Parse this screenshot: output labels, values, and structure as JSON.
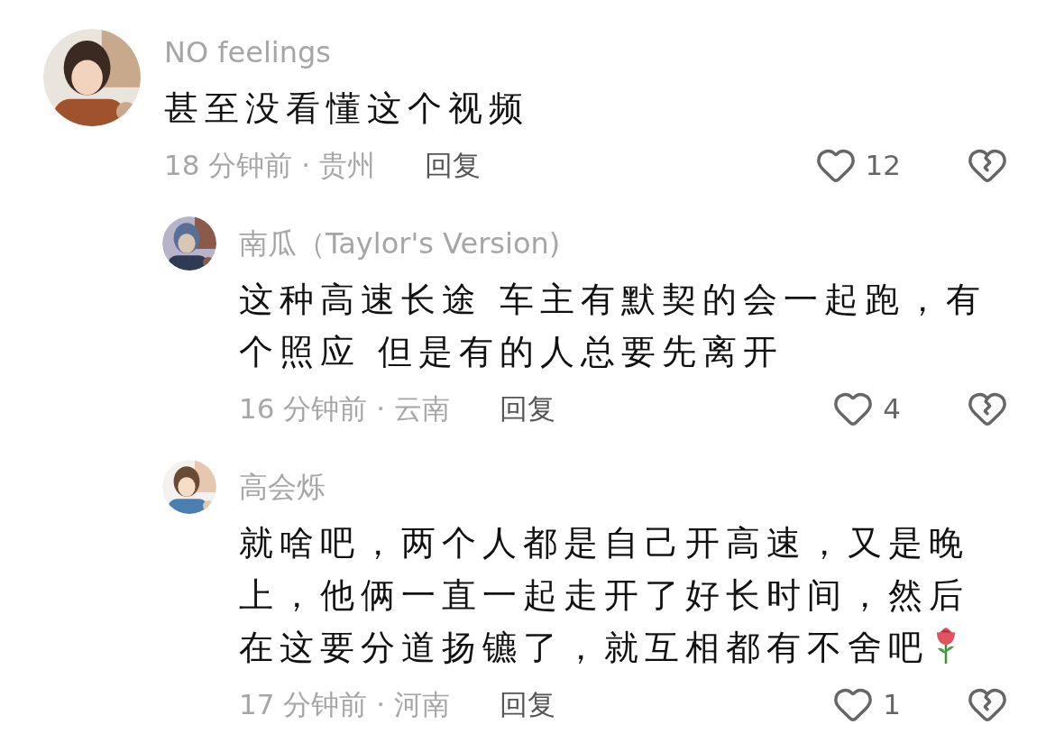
{
  "comments": [
    {
      "user": "NO feelings",
      "text": "甚至没看懂这个视频",
      "time": "18 分钟前 · 贵州",
      "reply": "回复",
      "likes": "12",
      "children": [
        {
          "user": "南瓜（Taylor's Version)",
          "text": "这种高速长途 车主有默契的会一起跑，有个照应 但是有的人总要先离开",
          "time": "16 分钟前 · 云南",
          "reply": "回复",
          "likes": "4"
        },
        {
          "user": "高会烁",
          "text": "就啥吧，两个人都是自己开高速，又是晚上，他俩一直一起走开了好长时间，然后在这要分道扬镳了，就互相都有不舍吧",
          "sticker": {
            "kind": "rose"
          },
          "time": "17 分钟前 · 河南",
          "reply": "回复",
          "likes": "1"
        }
      ]
    }
  ]
}
